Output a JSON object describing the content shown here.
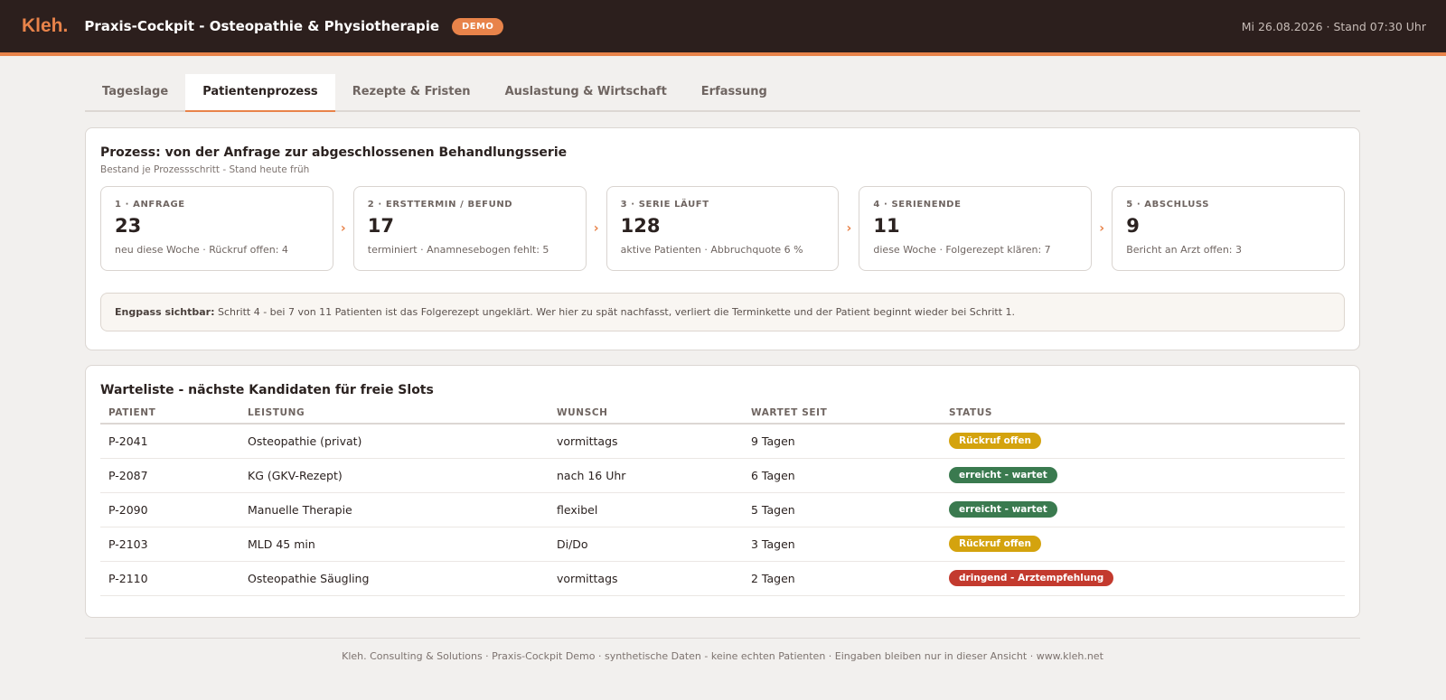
{
  "header": {
    "logo": "Kleh.",
    "title": "Praxis-Cockpit - Osteopathie & Physiotherapie",
    "badge": "DEMO",
    "date": "Mi 26.08.2026 · Stand 07:30 Uhr"
  },
  "tabs": [
    {
      "label": "Tageslage"
    },
    {
      "label": "Patientenprozess"
    },
    {
      "label": "Rezepte & Fristen"
    },
    {
      "label": "Auslastung & Wirtschaft"
    },
    {
      "label": "Erfassung"
    }
  ],
  "active_tab": "Patientenprozess",
  "process": {
    "title": "Prozess: von der Anfrage zur abgeschlossenen Behandlungsserie",
    "subtitle": "Bestand je Prozessschritt - Stand heute früh",
    "arrow": "›",
    "steps": [
      {
        "label": "1 · ANFRAGE",
        "value": "23",
        "note": "neu diese Woche · Rückruf offen: 4"
      },
      {
        "label": "2 · ERSTTERMIN / BEFUND",
        "value": "17",
        "note": "terminiert · Anamnesebogen fehlt: 5"
      },
      {
        "label": "3 · SERIE LÄUFT",
        "value": "128",
        "note": "aktive Patienten · Abbruchquote 6 %"
      },
      {
        "label": "4 · SERIENENDE",
        "value": "11",
        "note": "diese Woche · Folgerezept klären: 7"
      },
      {
        "label": "5 · ABSCHLUSS",
        "value": "9",
        "note": "Bericht an Arzt offen: 3"
      }
    ],
    "bottleneck_label": "Engpass sichtbar:",
    "bottleneck_text": " Schritt 4 - bei 7 von 11 Patienten ist das Folgerezept ungeklärt. Wer hier zu spät nachfasst, verliert die Terminkette und der Patient beginnt wieder bei Schritt 1."
  },
  "waitlist": {
    "title": "Warteliste - nächste Kandidaten für freie Slots",
    "columns": [
      "PATIENT",
      "LEISTUNG",
      "WUNSCH",
      "WARTET SEIT",
      "STATUS"
    ],
    "rows": [
      {
        "patient": "P-2041",
        "service": "Osteopathie (privat)",
        "wish": "vormittags",
        "waiting": "9 Tagen",
        "status": "Rückruf offen",
        "status_color": "#d4a30e"
      },
      {
        "patient": "P-2087",
        "service": "KG (GKV-Rezept)",
        "wish": "nach 16 Uhr",
        "waiting": "6 Tagen",
        "status": "erreicht - wartet",
        "status_color": "#3a7a4f"
      },
      {
        "patient": "P-2090",
        "service": "Manuelle Therapie",
        "wish": "flexibel",
        "waiting": "5 Tagen",
        "status": "erreicht - wartet",
        "status_color": "#3a7a4f"
      },
      {
        "patient": "P-2103",
        "service": "MLD 45 min",
        "wish": "Di/Do",
        "waiting": "3 Tagen",
        "status": "Rückruf offen",
        "status_color": "#d4a30e"
      },
      {
        "patient": "P-2110",
        "service": "Osteopathie Säugling",
        "wish": "vormittags",
        "waiting": "2 Tagen",
        "status": "dringend - Arztempfehlung",
        "status_color": "#c33a2e"
      }
    ]
  },
  "footer": {
    "text": "Kleh. Consulting & Solutions · Praxis-Cockpit Demo · synthetische Daten - keine echten Patienten · Eingaben bleiben nur in dieser Ansicht · www.kleh.net"
  },
  "colors": {
    "accent": "#e8834a",
    "header_bg": "#2c1f1d",
    "page_bg": "#f2f0ee"
  }
}
